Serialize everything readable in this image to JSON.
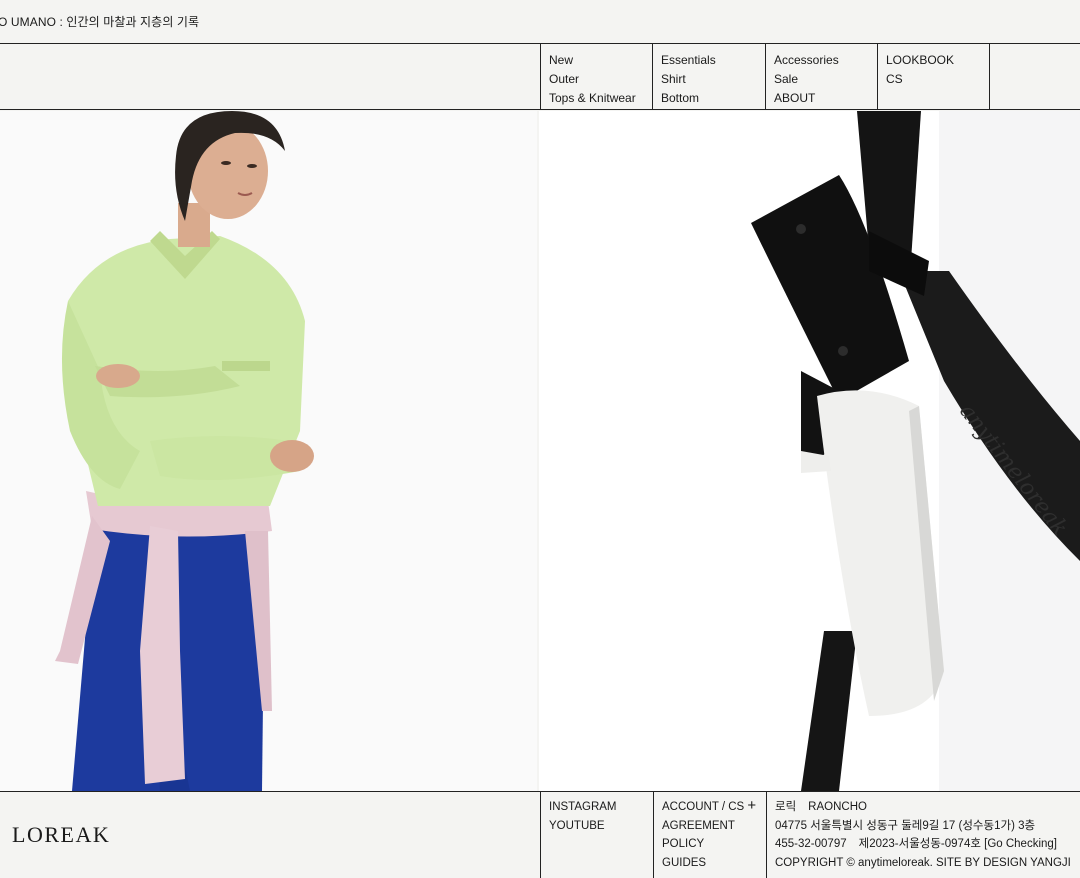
{
  "topbar": {
    "marquee_text": "O UMANO : 인간의 마찰과 지층의 기록"
  },
  "nav": {
    "col1": [
      "New",
      "Outer",
      "Tops & Knitwear"
    ],
    "col2": [
      "Essentials",
      "Shirt",
      "Bottom"
    ],
    "col3": [
      "Accessories",
      "Sale",
      "ABOUT"
    ],
    "col4": [
      "LOOKBOOK",
      "CS"
    ]
  },
  "hero": {
    "left_image": "model-in-green-shirt-photo",
    "right_image": "black-leather-belt-photo",
    "belt_lettering": "anytimeloreak"
  },
  "footer": {
    "logo": "LOREAK",
    "social": [
      "INSTAGRAM",
      "YOUTUBE"
    ],
    "links": {
      "account": "ACCOUNT / CS",
      "account_icon": "plus-icon",
      "items": [
        "AGREEMENT",
        "POLICY",
        "GUIDES"
      ]
    },
    "info": {
      "company_label": "로릭",
      "ceo": "RAONCHO",
      "address": "04775 서울특별시 성동구 둘레9길 17 (성수동1가) 3층",
      "biz_number": "455-32-00797",
      "mail_order": "제2023-서울성동-0974호 [Go Checking]",
      "copyright": "COPYRIGHT © anytimeloreak. SITE BY DESIGN YANGJI"
    }
  }
}
